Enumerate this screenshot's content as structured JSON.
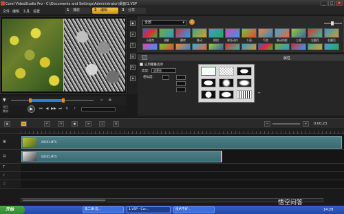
{
  "window": {
    "title": "Corel VideoStudio Pro - C:\\Documents and Settings\\Administrator\\桌面\\1.VSP",
    "controls": [
      "_",
      "□",
      "×"
    ]
  },
  "menu": [
    "文件",
    "编辑",
    "工具",
    "设置"
  ],
  "steps": [
    {
      "num": "1",
      "label": "捕获",
      "active": false
    },
    {
      "num": "2",
      "label": "编辑",
      "active": true
    },
    {
      "num": "3",
      "label": "分享",
      "active": false
    }
  ],
  "player": {
    "mode_labels": [
      "项目",
      "素材"
    ],
    "controls": [
      "⏮",
      "◀",
      "▶▶",
      "⏭",
      "↻"
    ]
  },
  "library": {
    "category": "全部",
    "transitions_row1": [
      "马赛克",
      "溶解",
      "翻转",
      "推动",
      "擦拭",
      "果冻动作",
      "千面",
      "气泡",
      "感动的影",
      "三维",
      "左翻页",
      "右翻页"
    ],
    "panel_title": "属性"
  },
  "options": {
    "apply_overlay": "应用覆叠选项",
    "type_label": "类型:",
    "type_value": "遮罩帧",
    "similar_label": "相似度:"
  },
  "timeline": {
    "clips": [
      {
        "label": "00201.MTS"
      },
      {
        "label": "00205.MTS"
      }
    ],
    "timecode": "0:00:23"
  },
  "taskbar": {
    "start": "开始",
    "items": [
      "第二课-选...",
      "1.VSP - Cor...",
      "技术不好..."
    ],
    "clock": "14:28"
  },
  "watermark": "悟空问答",
  "colors": {
    "accent": "#e0b030",
    "clip": "#4a7b82",
    "selection": "#2e7bd8"
  }
}
